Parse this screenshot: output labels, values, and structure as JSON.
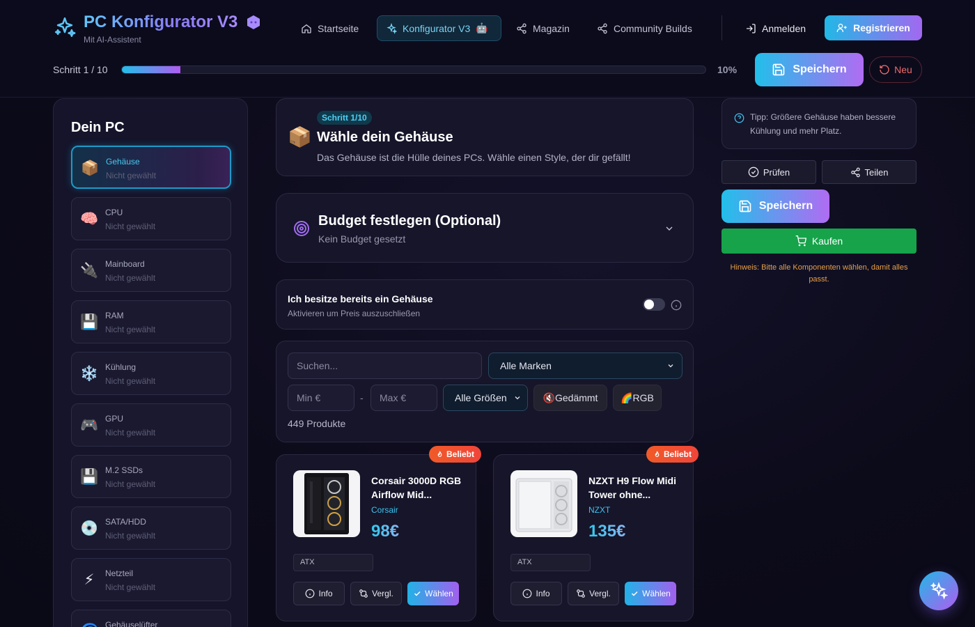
{
  "brand": {
    "title": "PC Konfigurator V3",
    "subtitle": "Mit AI-Assistent"
  },
  "nav": {
    "items": [
      {
        "label": "Startseite",
        "icon": "home-icon"
      },
      {
        "label": "Konfigurator V3",
        "icon": "sparkles-icon",
        "active": true
      },
      {
        "label": "Magazin",
        "icon": "share-icon"
      },
      {
        "label": "Community Builds",
        "icon": "share-icon"
      }
    ],
    "login": "Anmelden",
    "register": "Registrieren"
  },
  "progress": {
    "label": "Schritt 1 / 10",
    "percent_label": "10%",
    "fraction": 0.1
  },
  "toolbar": {
    "save": "Speichern",
    "new": "Neu"
  },
  "sidebar": {
    "title": "Dein PC",
    "items": [
      {
        "name": "Gehäuse",
        "status": "Nicht gewählt",
        "icon": "📦",
        "active": true
      },
      {
        "name": "CPU",
        "status": "Nicht gewählt",
        "icon": "🧠"
      },
      {
        "name": "Mainboard",
        "status": "Nicht gewählt",
        "icon": "🔌"
      },
      {
        "name": "RAM",
        "status": "Nicht gewählt",
        "icon": "💾"
      },
      {
        "name": "Kühlung",
        "status": "Nicht gewählt",
        "icon": "❄️"
      },
      {
        "name": "GPU",
        "status": "Nicht gewählt",
        "icon": "🎮"
      },
      {
        "name": "M.2 SSDs",
        "status": "Nicht gewählt",
        "icon": "💾"
      },
      {
        "name": "SATA/HDD",
        "status": "Nicht gewählt",
        "icon": "💿"
      },
      {
        "name": "Netzteil",
        "status": "Nicht gewählt",
        "icon": "⚡"
      },
      {
        "name": "Gehäuselüfter",
        "status": "",
        "icon": "🌀"
      }
    ]
  },
  "step": {
    "badge": "Schritt 1/10",
    "title": "Wähle dein Gehäuse",
    "description": "Das Gehäuse ist die Hülle deines PCs. Wähle einen Style, der dir gefällt!",
    "icon": "📦"
  },
  "budget": {
    "title": "Budget festlegen (Optional)",
    "subtitle": "Kein Budget gesetzt"
  },
  "own_case": {
    "title": "Ich besitze bereits ein Gehäuse",
    "subtitle": "Aktivieren um Preis auszuschließen",
    "enabled": false
  },
  "filters": {
    "search_placeholder": "Suchen...",
    "brand_select": "Alle Marken",
    "min_placeholder": "Min €",
    "max_placeholder": "Max €",
    "range_sep": "-",
    "size_select": "Alle Größen",
    "chip_insulated": "🔇Gedämmt",
    "chip_rgb": "🌈RGB",
    "product_count": "449 Produkte"
  },
  "products": [
    {
      "badge": "Beliebt",
      "name": "Corsair 3000D RGB Airflow Mid...",
      "brand": "Corsair",
      "price": "98€",
      "tag": "ATX",
      "btn_info": "Info",
      "btn_compare": "Vergl.",
      "btn_pick": "Wählen"
    },
    {
      "badge": "Beliebt",
      "name": "NZXT H9 Flow Midi Tower ohne...",
      "brand": "NZXT",
      "price": "135€",
      "tag": "ATX",
      "btn_info": "Info",
      "btn_compare": "Vergl.",
      "btn_pick": "Wählen"
    }
  ],
  "right_panel": {
    "tip": "Tipp: Größere Gehäuse haben bessere Kühlung und mehr Platz.",
    "check": "Prüfen",
    "share": "Teilen",
    "save": "Speichern",
    "buy": "Kaufen",
    "hint": "Hinweis: Bitte alle Komponenten wählen, damit alles passt."
  },
  "colors": {
    "accent_cyan": "#22bfea",
    "accent_purple": "#b06cf2",
    "buy_green": "#16a34a",
    "danger": "#f06a6a",
    "popular_badge": "#f0453a"
  }
}
